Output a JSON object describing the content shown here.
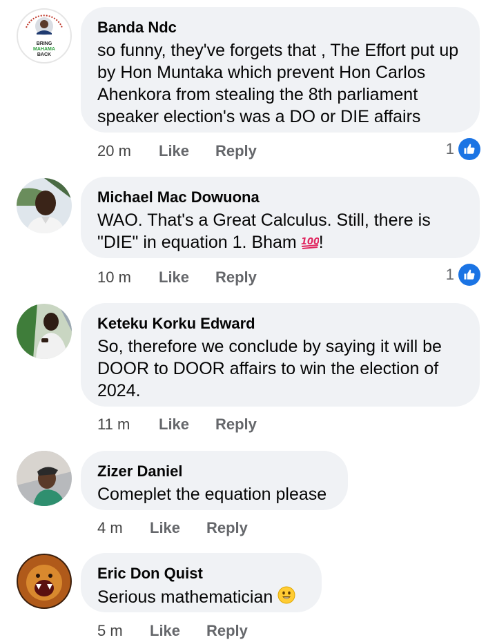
{
  "comments": [
    {
      "author": "Banda Ndc",
      "text": "so funny, they've forgets that , The Effort put up by Hon Muntaka which prevent Hon Carlos Ahenkora from stealing the 8th parliament speaker election's was a DO or DIE affairs",
      "time": "20 m",
      "like": "Like",
      "reply": "Reply",
      "likes": "1",
      "avatar_text": {
        "top": "BRING MAHAMA BACK FOR VICTORY",
        "l1": "BRING",
        "l2": "MAHAMA",
        "l3": "BACK"
      }
    },
    {
      "author": "Michael Mac Dowuona",
      "text": "WAO. That's a Great Calculus. Still, there is \"DIE\" in equation 1. Bham",
      "emoji": "100-icon",
      "text_suffix": "!",
      "time": "10 m",
      "like": "Like",
      "reply": "Reply",
      "likes": "1"
    },
    {
      "author": "Keteku Korku Edward",
      "text": "So, therefore we conclude by saying it will be DOOR to DOOR affairs to win the election of 2024.",
      "time": "11 m",
      "like": "Like",
      "reply": "Reply"
    },
    {
      "author": "Zizer Daniel",
      "text": "Comeplet the equation please",
      "time": "4 m",
      "like": "Like",
      "reply": "Reply"
    },
    {
      "author": "Eric Don Quist",
      "text": "Serious mathematician",
      "emoji": "smile-emoji-icon",
      "time": "5 m",
      "like": "Like",
      "reply": "Reply"
    }
  ],
  "colors": {
    "bubble": "#f0f2f5",
    "like_blue": "#1b74e4",
    "meta_gray": "#65676b",
    "hundred_red": "#e0245e"
  }
}
